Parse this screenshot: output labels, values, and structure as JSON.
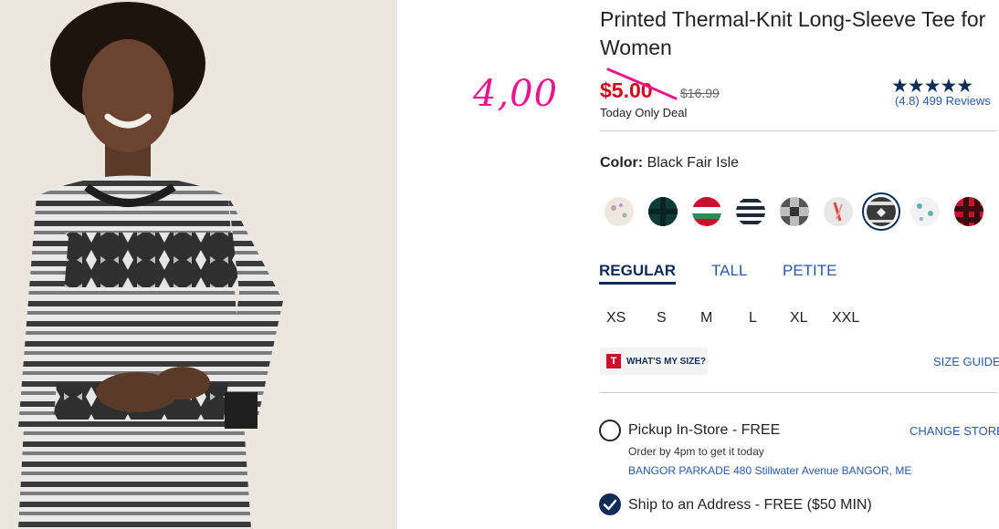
{
  "product": {
    "title": "Printed Thermal-Knit Long-Sleeve Tee for Women",
    "image_alt": "Model wearing black fair isle printed thermal-knit long-sleeve tee"
  },
  "annotation": {
    "handwritten_price": "4,00",
    "color": "#e8168a"
  },
  "price": {
    "sale": "$5.00",
    "original": "$16.99",
    "deal_label": "Today Only Deal",
    "sale_color": "#d0021b"
  },
  "rating": {
    "stars": "★★★★★",
    "summary": "(4.8) 499 Reviews",
    "score": 4.8
  },
  "color": {
    "label": "Color:",
    "selected": "Black Fair Isle",
    "swatches": [
      {
        "name": "cream-print",
        "selected": false
      },
      {
        "name": "dark-green-plaid",
        "selected": false
      },
      {
        "name": "red-white-green-stripe",
        "selected": false
      },
      {
        "name": "navy-white-stripe",
        "selected": false
      },
      {
        "name": "gray-buffalo-check",
        "selected": false
      },
      {
        "name": "candy-cane-print",
        "selected": false
      },
      {
        "name": "black-fair-isle",
        "selected": true
      },
      {
        "name": "teal-novelty-print",
        "selected": false
      },
      {
        "name": "red-buffalo-plaid",
        "selected": false
      }
    ]
  },
  "fit_tabs": [
    {
      "label": "REGULAR",
      "active": true
    },
    {
      "label": "TALL",
      "active": false
    },
    {
      "label": "PETITE",
      "active": false
    }
  ],
  "sizes": [
    "XS",
    "S",
    "M",
    "L",
    "XL",
    "XXL"
  ],
  "size_help": {
    "whats_my_size": "WHAT'S MY SIZE?",
    "badge_letter": "T",
    "size_guide": "SIZE GUIDE"
  },
  "fulfillment": {
    "pickup_label": "Pickup In-Store - FREE",
    "pickup_selected": false,
    "change_store": "CHANGE STORE",
    "order_by": "Order by 4pm to get it today",
    "store_address": "BANGOR PARKADE 480 Stillwater Avenue  BANGOR, ME",
    "ship_label": "Ship to an Address - FREE ($50 MIN)",
    "ship_selected": true
  },
  "colors": {
    "navy": "#0e2c55",
    "link": "#2a5aa5"
  }
}
